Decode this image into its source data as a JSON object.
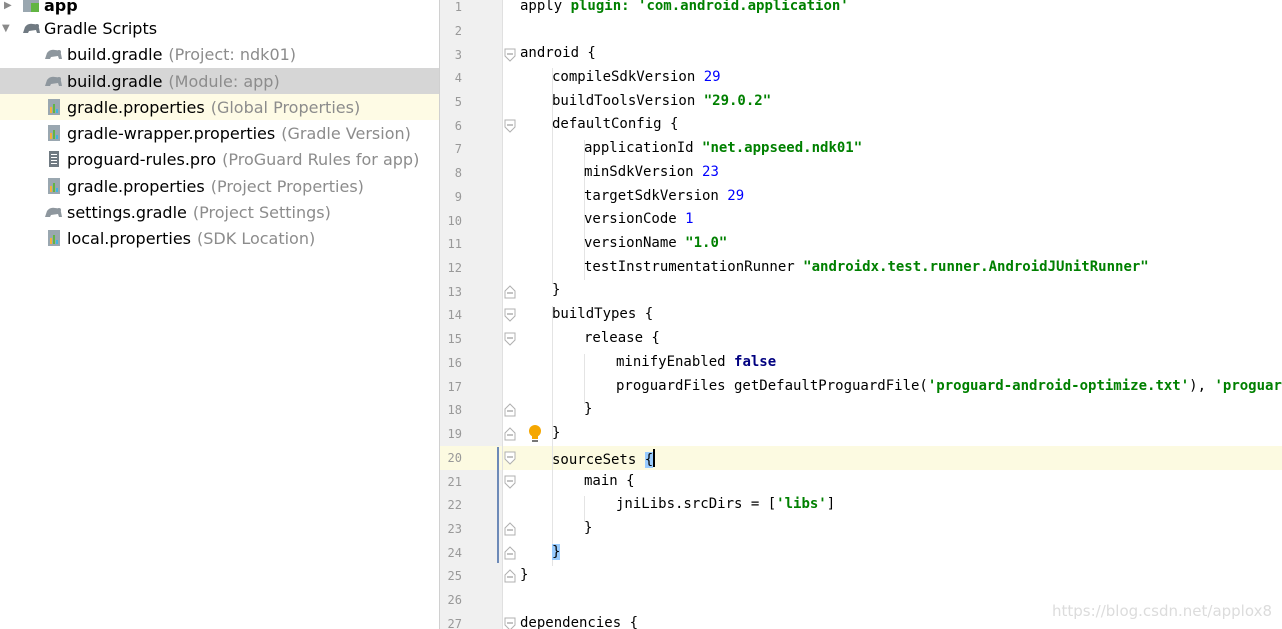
{
  "project_tree": {
    "rows": [
      {
        "name": "app",
        "desc": "",
        "icon": "module-folder-icon",
        "expanded": false
      },
      {
        "name": "Gradle Scripts",
        "desc": "",
        "icon": "gradle-scripts-icon",
        "expanded": true
      },
      {
        "name": "build.gradle",
        "desc": "(Project: ndk01)",
        "icon": "gradle-elephant-icon"
      },
      {
        "name": "build.gradle",
        "desc": "(Module: app)",
        "icon": "gradle-elephant-icon",
        "state": "selected"
      },
      {
        "name": "gradle.properties",
        "desc": "(Global Properties)",
        "icon": "properties-file-icon",
        "state": "highlight"
      },
      {
        "name": "gradle-wrapper.properties",
        "desc": "(Gradle Version)",
        "icon": "properties-file-icon"
      },
      {
        "name": "proguard-rules.pro",
        "desc": "(ProGuard Rules for app)",
        "icon": "text-file-icon"
      },
      {
        "name": "gradle.properties",
        "desc": "(Project Properties)",
        "icon": "properties-file-icon"
      },
      {
        "name": "settings.gradle",
        "desc": "(Project Settings)",
        "icon": "gradle-elephant-icon"
      },
      {
        "name": "local.properties",
        "desc": "(SDK Location)",
        "icon": "properties-file-icon"
      }
    ]
  },
  "editor": {
    "line_numbers": [
      "1",
      "2",
      "3",
      "4",
      "5",
      "6",
      "7",
      "8",
      "9",
      "10",
      "11",
      "12",
      "13",
      "14",
      "15",
      "16",
      "17",
      "18",
      "19",
      "20",
      "21",
      "22",
      "23",
      "24",
      "25",
      "26",
      "27"
    ],
    "code": {
      "l1": {
        "a": "apply ",
        "b": "plugin",
        "c": ": ",
        "d": "'com.android.application'"
      },
      "l3": "android {",
      "l4": {
        "a": "compileSdkVersion ",
        "b": "29"
      },
      "l5": {
        "a": "buildToolsVersion ",
        "b": "\"29.0.2\""
      },
      "l6": "defaultConfig {",
      "l7": {
        "a": "applicationId ",
        "b": "\"net.appseed.ndk01\""
      },
      "l8": {
        "a": "minSdkVersion ",
        "b": "23"
      },
      "l9": {
        "a": "targetSdkVersion ",
        "b": "29"
      },
      "l10": {
        "a": "versionCode ",
        "b": "1"
      },
      "l11": {
        "a": "versionName ",
        "b": "\"1.0\""
      },
      "l12": {
        "a": "testInstrumentationRunner ",
        "b": "\"androidx.test.runner.AndroidJUnitRunner\""
      },
      "l13": "}",
      "l14": "buildTypes {",
      "l15": "release {",
      "l16": {
        "a": "minifyEnabled ",
        "b": "false"
      },
      "l17": {
        "a": "proguardFiles getDefaultProguardFile(",
        "b": "'proguard-android-optimize.txt'",
        "c": "), ",
        "d": "'proguard-rules.pro'"
      },
      "l18": "}",
      "l19": "}",
      "l20": {
        "a": "sourceSets ",
        "b": "{"
      },
      "l21": "main {",
      "l22": {
        "a": "jniLibs.srcDirs = [",
        "b": "'libs'",
        "c": "]"
      },
      "l23": "}",
      "l24": "}",
      "l25": "}",
      "l27": "dependencies {"
    },
    "colors": {
      "keyword": "#000080",
      "string": "#008000",
      "number": "#0000ff",
      "current_line": "#fcfae1",
      "brace_match": "#99ccff"
    }
  },
  "intention_bulb_icon": "lightbulb-icon",
  "watermark": "https://blog.csdn.net/applox8"
}
